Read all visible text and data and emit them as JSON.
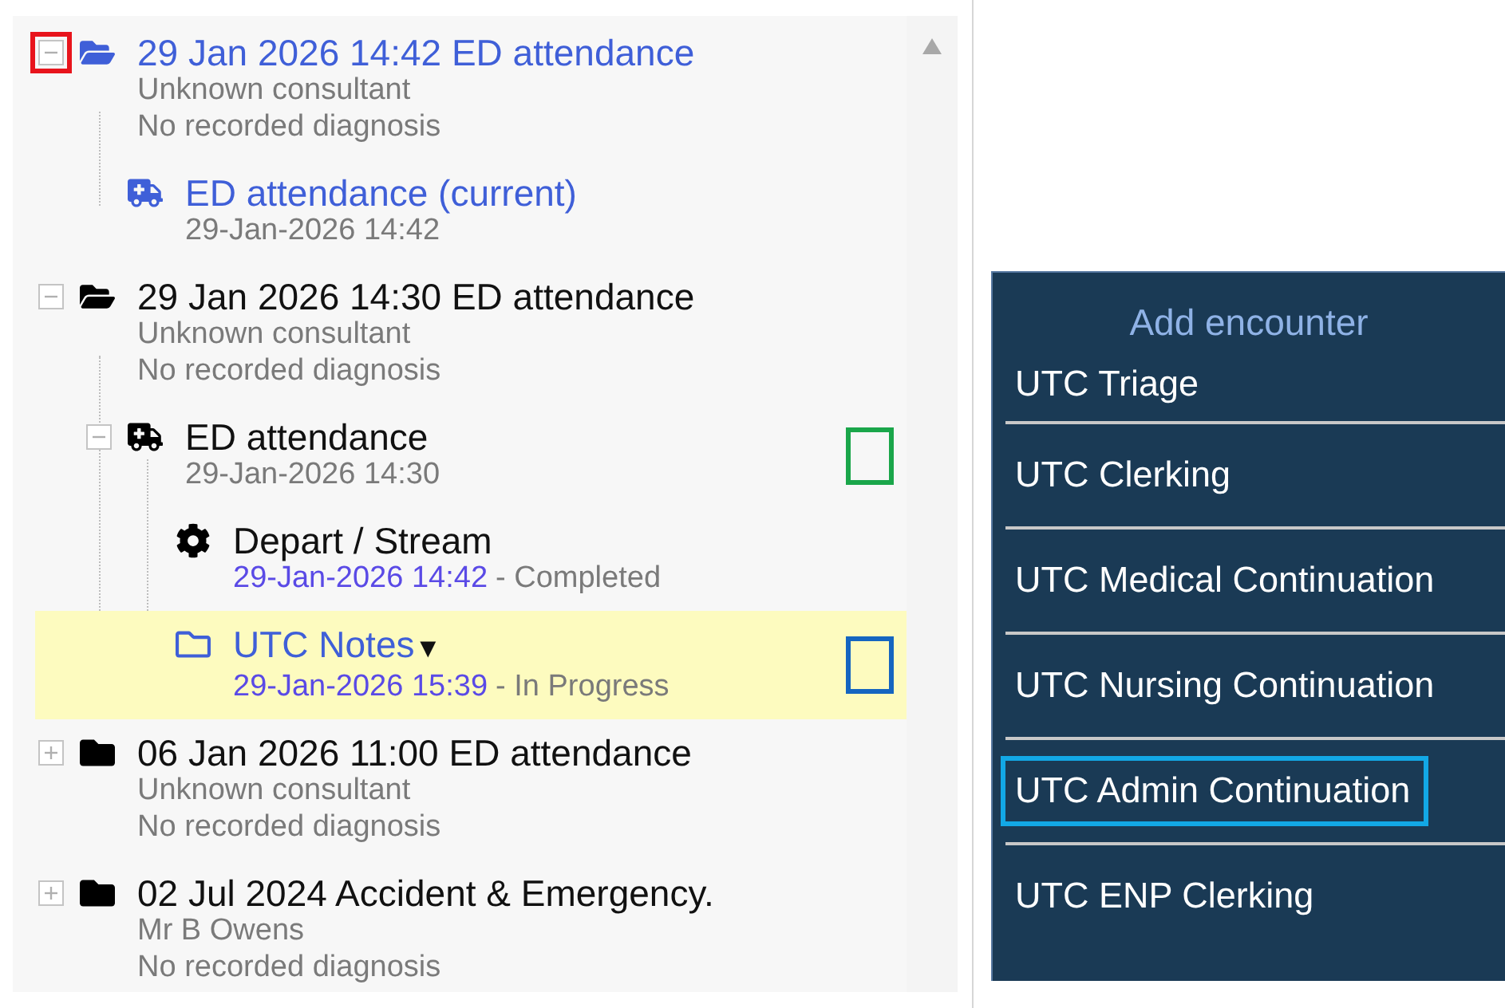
{
  "tree": [
    {
      "title": "29 Jan 2026 14:42 ED attendance",
      "kind": "open-folder",
      "link": true,
      "selected": false,
      "expander": {
        "expanded": true,
        "color": "#e8141c"
      },
      "lines": [
        "Unknown consultant",
        "No recorded diagnosis"
      ],
      "children": [
        {
          "title": "ED attendance (current)",
          "kind": "ambulance",
          "link": true,
          "selected": false,
          "date": "29-Jan-2026 14:42",
          "date_link": false
        }
      ]
    },
    {
      "title": "29 Jan 2026 14:30 ED attendance",
      "kind": "open-folder",
      "link": false,
      "selected": false,
      "expander": {
        "expanded": true
      },
      "lines": [
        "Unknown consultant",
        "No recorded diagnosis"
      ],
      "children": [
        {
          "title": "ED attendance",
          "kind": "ambulance",
          "link": false,
          "selected": false,
          "expander": {
            "expanded": true
          },
          "date": "29-Jan-2026 14:30",
          "date_link": false,
          "color": "#1aa64a",
          "children": [
            {
              "title": "Depart / Stream",
              "kind": "gear",
              "link": false,
              "selected": false,
              "date": "29-Jan-2026 14:42",
              "date_link": true,
              "status": "- Completed"
            },
            {
              "title": "UTC Notes",
              "caret": "▼",
              "kind": "outline-folder",
              "link": true,
              "selected": true,
              "date": "29-Jan-2026 15:39",
              "date_link": true,
              "status": "- In Progress",
              "color": "#1565c0"
            }
          ]
        }
      ]
    },
    {
      "title": "06 Jan 2026 11:00 ED attendance",
      "kind": "folder",
      "link": false,
      "selected": false,
      "expander": {
        "expanded": false
      },
      "lines": [
        "Unknown consultant",
        "No recorded diagnosis"
      ]
    },
    {
      "title": "02 Jul 2024 Accident & Emergency.",
      "kind": "folder",
      "link": false,
      "selected": false,
      "expander": {
        "expanded": false
      },
      "lines": [
        "Mr B Owens",
        "No recorded diagnosis"
      ]
    }
  ],
  "menu": {
    "title": "Add encounter",
    "items": [
      {
        "label": "UTC Triage"
      },
      {
        "label": "UTC Clerking"
      },
      {
        "label": "UTC Medical Continuation"
      },
      {
        "label": "UTC Nursing Continuation"
      },
      {
        "label": "UTC Admin Continuation",
        "color": "#12a8e6"
      },
      {
        "label": "UTC ENP Clerking"
      }
    ]
  }
}
